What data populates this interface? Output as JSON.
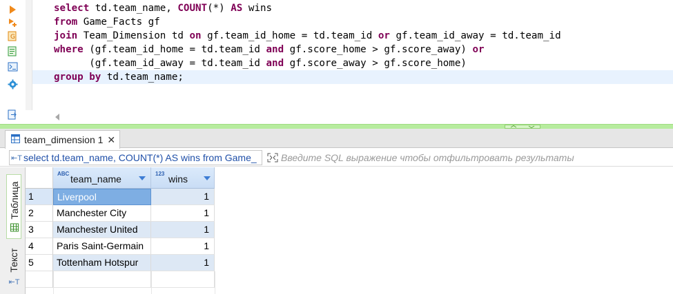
{
  "editor": {
    "lines": [
      [
        [
          "kw",
          "select"
        ],
        [
          "t",
          " td.team_name, "
        ],
        [
          "kw",
          "COUNT"
        ],
        [
          "t",
          "(*) "
        ],
        [
          "kw",
          "AS"
        ],
        [
          "t",
          " wins"
        ]
      ],
      [
        [
          "kw",
          "from"
        ],
        [
          "t",
          " Game_Facts gf"
        ]
      ],
      [
        [
          "kw",
          "join"
        ],
        [
          "t",
          " Team_Dimension td "
        ],
        [
          "kw",
          "on"
        ],
        [
          "t",
          " gf.team_id_home = td.team_id "
        ],
        [
          "kw",
          "or"
        ],
        [
          "t",
          " gf.team_id_away = td.team_id"
        ]
      ],
      [
        [
          "kw",
          "where"
        ],
        [
          "t",
          " (gf.team_id_home = td.team_id "
        ],
        [
          "kw",
          "and"
        ],
        [
          "t",
          " gf.score_home > gf.score_away) "
        ],
        [
          "kw",
          "or"
        ]
      ],
      [
        [
          "t",
          "      (gf.team_id_away = td.team_id "
        ],
        [
          "kw",
          "and"
        ],
        [
          "t",
          " gf.score_away > gf.score_home)"
        ]
      ],
      [
        [
          "kw",
          "group by"
        ],
        [
          "t",
          " td.team_name;"
        ]
      ]
    ],
    "current_line": 5,
    "toolbar": [
      "execute-statement-icon",
      "execute-script-icon",
      "export-icon",
      "script-icon",
      "terminal-icon",
      "settings-gear-icon",
      "output-icon"
    ]
  },
  "results": {
    "tab_label": "team_dimension 1",
    "tab_close": "✕",
    "filter_query": "select td.team_name, COUNT(*) AS wins from Game_",
    "filter_placeholder": "Введите SQL выражение чтобы отфильтровать результаты",
    "side_tabs": {
      "table": "Таблица",
      "text": "Текст"
    },
    "columns": [
      {
        "type_badge": "ABC",
        "name": "team_name"
      },
      {
        "type_badge": "123",
        "name": "wins"
      }
    ],
    "rows": [
      {
        "num": "1",
        "team_name": "Liverpool",
        "wins": "1"
      },
      {
        "num": "2",
        "team_name": "Manchester City",
        "wins": "1"
      },
      {
        "num": "3",
        "team_name": "Manchester United",
        "wins": "1"
      },
      {
        "num": "4",
        "team_name": "Paris Saint-Germain",
        "wins": "1"
      },
      {
        "num": "5",
        "team_name": "Tottenham Hotspur",
        "wins": "1"
      }
    ],
    "selected_row": 0
  },
  "colors": {
    "keyword": "#7f0055",
    "splitter": "#b7ec9e",
    "header_blue": "#c9ddf5",
    "selection": "#7eaee3"
  }
}
